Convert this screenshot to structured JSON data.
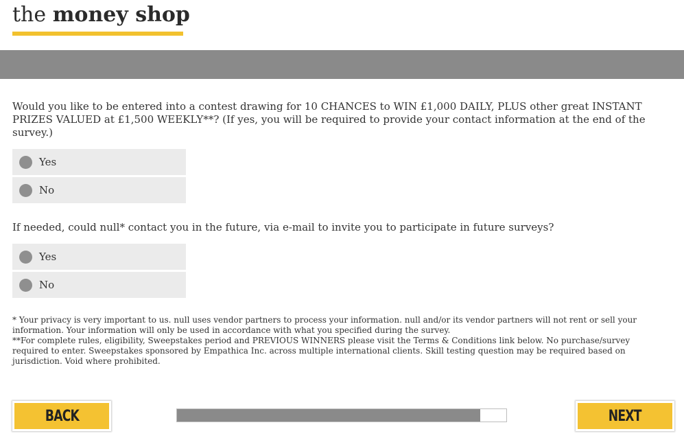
{
  "header": {
    "logo_prefix": "the",
    "logo_brand": "money shop",
    "accent_color": "#f2c12e"
  },
  "banner": {
    "color": "#8a8a8a"
  },
  "questions": [
    {
      "text": "Would you like to be entered into a contest drawing for 10 CHANCES to WIN £1,000 DAILY, PLUS other great INSTANT PRIZES VALUED at £1,500 WEEKLY**? (If yes, you will be required to provide your contact information at the end of the survey.)",
      "options": [
        "Yes",
        "No"
      ],
      "selected": null
    },
    {
      "text": "If needed, could null* contact you in the future, via e-mail to invite you to participate in future surveys?",
      "options": [
        "Yes",
        "No"
      ],
      "selected": null
    }
  ],
  "footnotes": {
    "privacy": "* Your privacy is very important to us. null uses vendor partners to process your information. null and/or its vendor partners will not rent or sell your information. Your information will only be used in accordance with what you specified during the survey.",
    "rules": "**For complete rules, eligibility, Sweepstakes period and PREVIOUS WINNERS please visit the Terms & Conditions link below. No purchase/survey required to enter. Sweepstakes sponsored by Empathica Inc. across multiple international clients. Skill testing question may be required based on jurisdiction. Void where prohibited."
  },
  "navigation": {
    "back_label": "BACK",
    "next_label": "NEXT",
    "button_color": "#f4c232"
  },
  "progress": {
    "fraction": 0.92
  }
}
